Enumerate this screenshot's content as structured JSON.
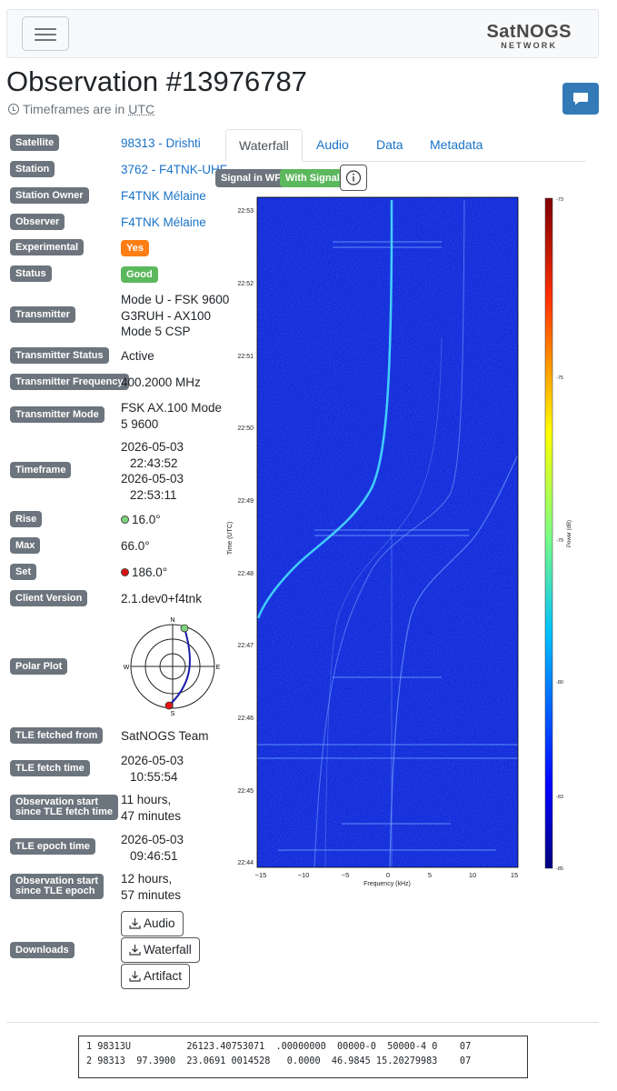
{
  "brand": {
    "name": "SatNOGS",
    "sub": "NETWORK"
  },
  "title": "Observation #13976787",
  "timezone_note": "Timeframes are in",
  "timezone": "UTC",
  "info": {
    "satellite": {
      "label": "Satellite",
      "value": "98313 - Drishti"
    },
    "station": {
      "label": "Station",
      "value": "3762 - F4TNK-UHF"
    },
    "station_owner": {
      "label": "Station Owner",
      "value": "F4TNK Mélaine"
    },
    "observer": {
      "label": "Observer",
      "value": "F4TNK Mélaine"
    },
    "experimental": {
      "label": "Experimental",
      "value": "Yes"
    },
    "status": {
      "label": "Status",
      "value": "Good"
    },
    "transmitter": {
      "label": "Transmitter",
      "line1": "Mode U - FSK 9600",
      "line2": "G3RUH - AX100",
      "line3": "Mode 5 CSP"
    },
    "transmitter_status": {
      "label": "Transmitter Status",
      "value": "Active"
    },
    "transmitter_frequency": {
      "label": "Transmitter Frequency",
      "value": "400.2000 MHz"
    },
    "transmitter_mode": {
      "label": "Transmitter Mode",
      "line1": "FSK AX.100 Mode",
      "line2": "5 9600"
    },
    "timeframe": {
      "label": "Timeframe",
      "start_date": "2026-05-03",
      "start_time": "22:43:52",
      "end_date": "2026-05-03",
      "end_time": "22:53:11"
    },
    "rise": {
      "label": "Rise",
      "value": "16.0°"
    },
    "max": {
      "label": "Max",
      "value": "66.0°"
    },
    "set": {
      "label": "Set",
      "value": "186.0°"
    },
    "client_version": {
      "label": "Client Version",
      "value": "2.1.dev0+f4tnk"
    },
    "polar_plot": {
      "label": "Polar Plot",
      "n": "N",
      "e": "E",
      "s": "S",
      "w": "W"
    },
    "tle_fetched_from": {
      "label": "TLE fetched from",
      "value": "SatNOGS Team"
    },
    "tle_fetch_time": {
      "label": "TLE fetch time",
      "date": "2026-05-03",
      "time": "10:55:54"
    },
    "obs_start_since_fetch": {
      "label_line1": "Observation start",
      "label_line2": "since TLE fetch time",
      "line1": "11 hours,",
      "line2": "47 minutes"
    },
    "tle_epoch_time": {
      "label": "TLE epoch time",
      "date": "2026-05-03",
      "time": "09:46:51"
    },
    "obs_start_since_epoch": {
      "label_line1": "Observation start",
      "label_line2": "since TLE epoch",
      "line1": "12 hours,",
      "line2": "57 minutes"
    },
    "downloads": {
      "label": "Downloads",
      "audio": "Audio",
      "waterfall": "Waterfall",
      "artifact": "Artifact"
    }
  },
  "tabs": [
    "Waterfall",
    "Audio",
    "Data",
    "Metadata"
  ],
  "tags": {
    "signal_in_wf": "Signal in WF",
    "with_signal": "With Signal"
  },
  "colors": {
    "label_bg": "#6c757d",
    "link": "#1a73c8",
    "experimental": "#fd7e14",
    "good": "#5cb85c",
    "comment_btn": "#337ab7"
  },
  "waterfall": {
    "y_label": "Time (UTC)",
    "x_label": "Frequency (kHz)",
    "colorbar_label": "Power (dB)",
    "y_ticks": [
      "22:53",
      "22:52",
      "22:51",
      "22:50",
      "22:49",
      "22:48",
      "22:47",
      "22:46",
      "22:45",
      "22:44"
    ],
    "x_ticks": [
      "−15",
      "−10",
      "−5",
      "0",
      "5",
      "10",
      "15"
    ],
    "colorbar_ticks": [
      "-73",
      "-75",
      "-79",
      "-80",
      "-83",
      "-85"
    ]
  },
  "tle": {
    "line1": "1 98313U          26123.40753071  .00000000  00000-0  50000-4 0    07",
    "line2": "2 98313  97.3900  23.0691 0014528   0.0000  46.9845 15.20279983    07"
  }
}
